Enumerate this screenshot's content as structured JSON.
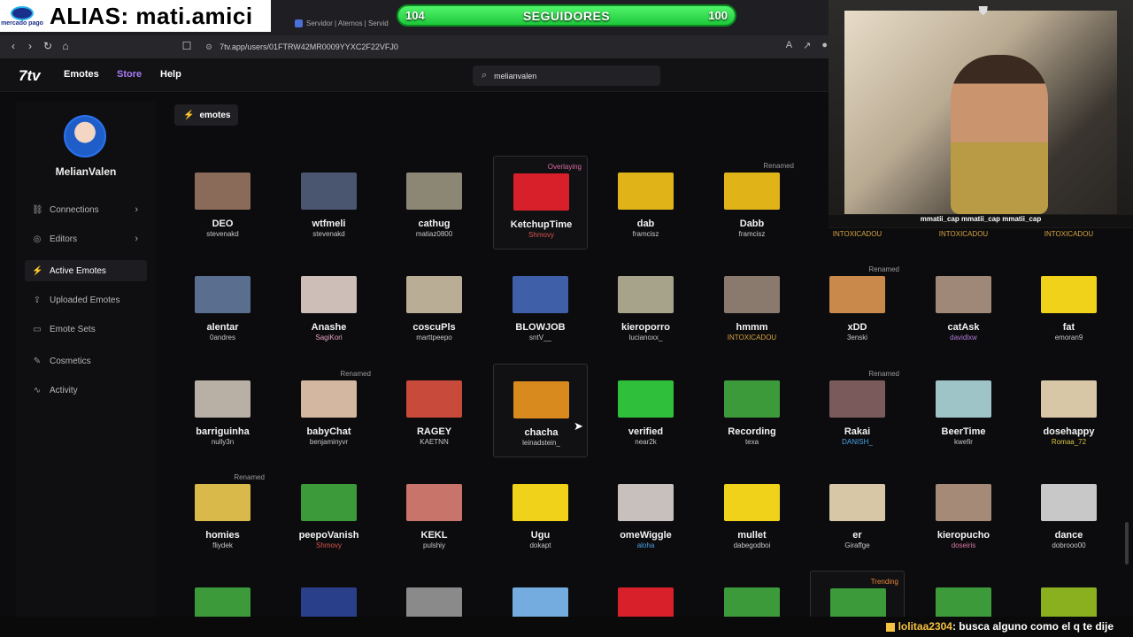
{
  "overlay": {
    "alias_label": "ALIAS: mati.amici",
    "mp_logo_text": "mercado pago",
    "follow_left": "104",
    "follow_title": "SEGUIDORES",
    "follow_right": "100",
    "cam_socials": "mmatii_cap  mmatii_cap  mmatii_cap",
    "chat_user": "lolitaa2304",
    "chat_text": ": busca alguno como el q te dije"
  },
  "browser": {
    "tab_title": "Servidor | Aternos | Servid",
    "url": "7tv.app/users/01FTRW42MR0009YYXC2F22VFJ0"
  },
  "header": {
    "logo": "7tv",
    "nav": [
      "Emotes",
      "Store",
      "Help"
    ],
    "search_value": "melianvalen"
  },
  "sidebar": {
    "username": "MelianValen",
    "items": [
      {
        "label": "Connections",
        "icon": "link-icon",
        "chev": true
      },
      {
        "label": "Editors",
        "icon": "user-icon",
        "chev": true
      },
      {
        "label": "Active Emotes",
        "icon": "bolt-icon",
        "chev": false
      },
      {
        "label": "Uploaded Emotes",
        "icon": "upload-icon",
        "chev": false
      },
      {
        "label": "Emote Sets",
        "icon": "folder-icon",
        "chev": false
      },
      {
        "label": "Cosmetics",
        "icon": "brush-icon",
        "chev": false
      },
      {
        "label": "Activity",
        "icon": "activity-icon",
        "chev": false
      }
    ]
  },
  "chip_label": "emotes",
  "emotes": [
    [
      {
        "name": "DEO",
        "owner": "stevenakd",
        "color": "#8a6b5a"
      },
      {
        "name": "wtfmeli",
        "owner": "stevenakd",
        "color": "#4a5570"
      },
      {
        "name": "cathug",
        "owner": "matiaz0800",
        "color": "#8c8674"
      },
      {
        "name": "KetchupTime",
        "owner": "Shmovy",
        "ownerColor": "#d9534f",
        "color": "#d8202a",
        "tag": "Overlaying",
        "tagType": "overlay",
        "hl": true
      },
      {
        "name": "dab",
        "owner": "framcisz",
        "color": "#e0b419"
      },
      {
        "name": "Dabb",
        "owner": "framcisz",
        "color": "#e0b419",
        "tag": "Renamed"
      },
      {
        "name": "",
        "owner": "INTOXICADOU",
        "ownerColor": "#d9a441",
        "color": ""
      },
      {
        "name": "",
        "owner": "INTOXICADOU",
        "ownerColor": "#d9a441",
        "color": ""
      },
      {
        "name": "",
        "owner": "INTOXICADOU",
        "ownerColor": "#d9a441",
        "color": ""
      }
    ],
    [
      {
        "name": "alentar",
        "owner": "0andres",
        "color": "#5a6f8f"
      },
      {
        "name": "Anashe",
        "owner": "SagiKori",
        "ownerColor": "#e7a3c3",
        "color": "#cdbfb8"
      },
      {
        "name": "coscuPls",
        "owner": "marttpeepo",
        "color": "#b9ad96"
      },
      {
        "name": "BLOWJOB",
        "owner": "sntV__",
        "color": "#3f5fa8"
      },
      {
        "name": "kieroporro",
        "owner": "lucianoxx_",
        "color": "#a6a38a"
      },
      {
        "name": "hmmm",
        "owner": "INTOXICADOU",
        "ownerColor": "#d9a441",
        "color": "#8a7a6e"
      },
      {
        "name": "xDD",
        "owner": "3enski",
        "color": "#c8894a",
        "tag": "Renamed"
      },
      {
        "name": "catAsk",
        "owner": "davidlxw",
        "ownerColor": "#b07ad9",
        "color": "#a08878"
      },
      {
        "name": "fat",
        "owner": "emoran9",
        "color": "#f0d21a"
      }
    ],
    [
      {
        "name": "barriguinha",
        "owner": "nully3n",
        "color": "#b8b0a4"
      },
      {
        "name": "babyChat",
        "owner": "benjaminyvr",
        "color": "#d4b7a0",
        "tag": "Renamed"
      },
      {
        "name": "RAGEY",
        "owner": "KAETNN",
        "color": "#c84a3a"
      },
      {
        "name": "chacha",
        "owner": "leinadstein_",
        "color": "#d98a1f",
        "hl": true
      },
      {
        "name": "verified",
        "owner": "near2k",
        "color": "#2fbf3a"
      },
      {
        "name": "Recording",
        "owner": "texa",
        "color": "#3c9a3a"
      },
      {
        "name": "Rakai",
        "owner": "DANISH_",
        "ownerColor": "#4aa3e8",
        "color": "#7a5a5a",
        "tag": "Renamed"
      },
      {
        "name": "BeerTime",
        "owner": "kwefir",
        "color": "#9fc4c8"
      },
      {
        "name": "dosehappy",
        "owner": "Romaa_72",
        "ownerColor": "#d9c441",
        "color": "#d8c7a6"
      }
    ],
    [
      {
        "name": "homies",
        "owner": "fliydek",
        "color": "#d9b94a",
        "tag": "Renamed"
      },
      {
        "name": "peepoVanish",
        "owner": "Shmovy",
        "ownerColor": "#d9534f",
        "color": "#3c9a3a"
      },
      {
        "name": "KEKL",
        "owner": "pulshiy",
        "color": "#c8746a"
      },
      {
        "name": "Ugu",
        "owner": "dokapt",
        "color": "#f0d21a"
      },
      {
        "name": "omeWiggle",
        "owner": "aloha",
        "ownerColor": "#4aa3e8",
        "color": "#c8c0bc"
      },
      {
        "name": "mullet",
        "owner": "dabegodboi",
        "color": "#f0d21a"
      },
      {
        "name": "er",
        "owner": "Giraffge",
        "color": "#d8c7a6"
      },
      {
        "name": "kieropucho",
        "owner": "doseiris",
        "ownerColor": "#d97aa4",
        "color": "#a68a78"
      },
      {
        "name": "dance",
        "owner": "dobrooo00",
        "color": "#c8c8c8"
      }
    ],
    [
      {
        "name": "",
        "owner": "",
        "color": "#3c9a3a"
      },
      {
        "name": "",
        "owner": "",
        "color": "#2a3f8a"
      },
      {
        "name": "",
        "owner": "",
        "color": "#8a8a8a"
      },
      {
        "name": "",
        "owner": "",
        "color": "#74acdf"
      },
      {
        "name": "",
        "owner": "",
        "color": "#d8202a"
      },
      {
        "name": "",
        "owner": "",
        "color": "#3c9a3a"
      },
      {
        "name": "",
        "owner": "",
        "color": "#3c9a3a",
        "tag": "Trending",
        "tagType": "trend",
        "hl": true
      },
      {
        "name": "",
        "owner": "",
        "color": "#3c9a3a"
      },
      {
        "name": "",
        "owner": "",
        "color": "#8ab020"
      }
    ]
  ]
}
